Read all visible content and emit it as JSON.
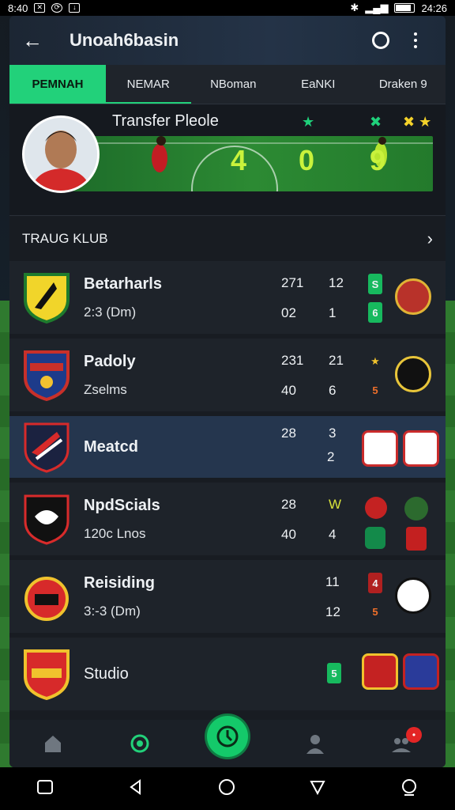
{
  "status_bar": {
    "time_left": "8:40",
    "time_right": "24:26"
  },
  "header": {
    "title": "Unoah6basin",
    "back_icon": "arrow-left-icon",
    "action_icon": "ring-icon",
    "menu_icon": "more-vert-icon"
  },
  "tabs": [
    {
      "label": "PEMNAH",
      "active": true
    },
    {
      "label": "NEMAR",
      "active": false
    },
    {
      "label": "NBoman",
      "active": false
    },
    {
      "label": "EaNKI",
      "active": false
    },
    {
      "label": "Draken 9",
      "active": false
    }
  ],
  "hero": {
    "title": "Transfer Pleole",
    "marks": [
      "★",
      "✖",
      "✖ ★"
    ],
    "score": [
      "4",
      "0",
      "9"
    ]
  },
  "section": {
    "title": "TRAUG KLUB"
  },
  "clubs": [
    {
      "name": "Betarharls",
      "subtitle": "2:3 (Dm)",
      "stat1": "271",
      "stat2": "12",
      "stat3": "02",
      "stat4": "1",
      "badge1": "S",
      "badge2": "6"
    },
    {
      "name": "Padoly",
      "subtitle": "Zselms",
      "stat1": "231",
      "stat2": "21",
      "stat3": "40",
      "stat4": "6",
      "badge1": "★",
      "badge2": "5"
    },
    {
      "name": "Meatcd",
      "subtitle": "",
      "stat1": "28",
      "stat2": "3",
      "stat3": "",
      "stat4": "2",
      "badge1": "",
      "badge2": ""
    },
    {
      "name": "NpdScials",
      "subtitle": "120c Lnos",
      "stat1": "28",
      "stat2": "W",
      "stat3": "40",
      "stat4": "4",
      "badge1": "",
      "badge2": ""
    },
    {
      "name": "Reisiding",
      "subtitle": "3:-3 (Dm)",
      "stat1": "",
      "stat2": "11",
      "stat3": "",
      "stat4": "12",
      "badge1": "4",
      "badge2": "5"
    },
    {
      "name": "Studio",
      "subtitle": "",
      "stat1": "",
      "stat2": "",
      "stat3": "",
      "stat4": "",
      "badge1": "5",
      "badge2": ""
    }
  ],
  "bottom_nav": {
    "notif_count": "•"
  },
  "colors": {
    "accent": "#22d17a",
    "score": "#c9f23c",
    "selected_row": "#25364e"
  }
}
